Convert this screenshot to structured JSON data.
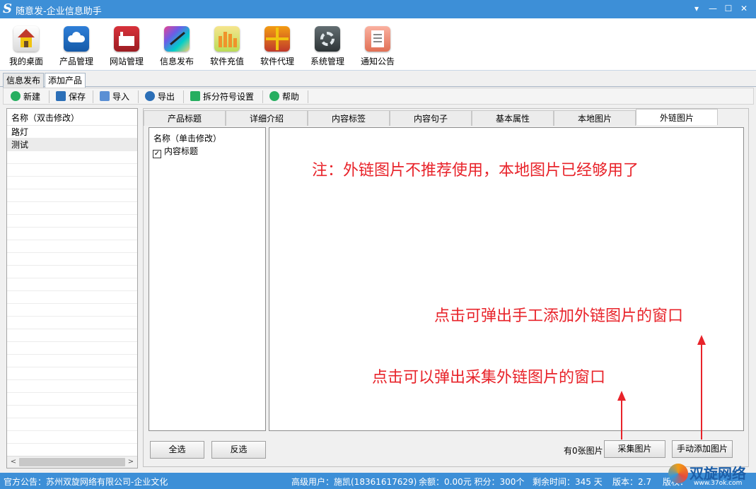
{
  "window": {
    "logo": "S",
    "title": "随意发-企业信息助手",
    "btn_menu": "▾",
    "btn_min": "—",
    "btn_max": "☐",
    "btn_close": "✕"
  },
  "ribbon": [
    {
      "label": "我的桌面",
      "icon": "home-icon"
    },
    {
      "label": "产品管理",
      "icon": "cloud-icon"
    },
    {
      "label": "网站管理",
      "icon": "factory-icon"
    },
    {
      "label": "信息发布",
      "icon": "magic-wand-icon"
    },
    {
      "label": "软件充值",
      "icon": "coins-icon"
    },
    {
      "label": "软件代理",
      "icon": "gift-icon"
    },
    {
      "label": "系统管理",
      "icon": "gear-icon"
    },
    {
      "label": "通知公告",
      "icon": "notice-icon"
    }
  ],
  "tabs": [
    "信息发布",
    "添加产品"
  ],
  "toolbar": {
    "new": "新建",
    "save": "保存",
    "import": "导入",
    "export": "导出",
    "split": "拆分符号设置",
    "help": "帮助"
  },
  "left_list": {
    "header": "名称（双击修改）",
    "items": [
      "路灯",
      "测试"
    ]
  },
  "inner_tabs": [
    "产品标题",
    "详细介绍",
    "内容标签",
    "内容句子",
    "基本属性",
    "本地图片",
    "外链图片"
  ],
  "name_box": {
    "header": "名称（单击修改）",
    "item": "内容标题",
    "checked": "✓"
  },
  "notes": {
    "top": "注：外链图片不推荐使用，本地图片已经够用了",
    "manual": "点击可弹出手工添加外链图片的窗口",
    "collect": "点击可以弹出采集外链图片的窗口"
  },
  "buttons": {
    "select_all": "全选",
    "invert": "反选",
    "collect": "采集图片",
    "manual_add": "手动添加图片"
  },
  "image_count": "有0张图片",
  "status": {
    "notice": "官方公告：苏州双旋网络有限公司-企业文化",
    "user": "高级用户：施凯(18361617629)",
    "balance": "余额：0.00元 积分：300个",
    "remaining": "剩余时间：345 天",
    "version": "版本：2.7",
    "version_more": "版权："
  },
  "watermark": {
    "name": "双旋网络",
    "url": "www.37ok.com"
  },
  "colors": {
    "titlebar": "#3d8fd7",
    "note_red": "#e8232a"
  }
}
